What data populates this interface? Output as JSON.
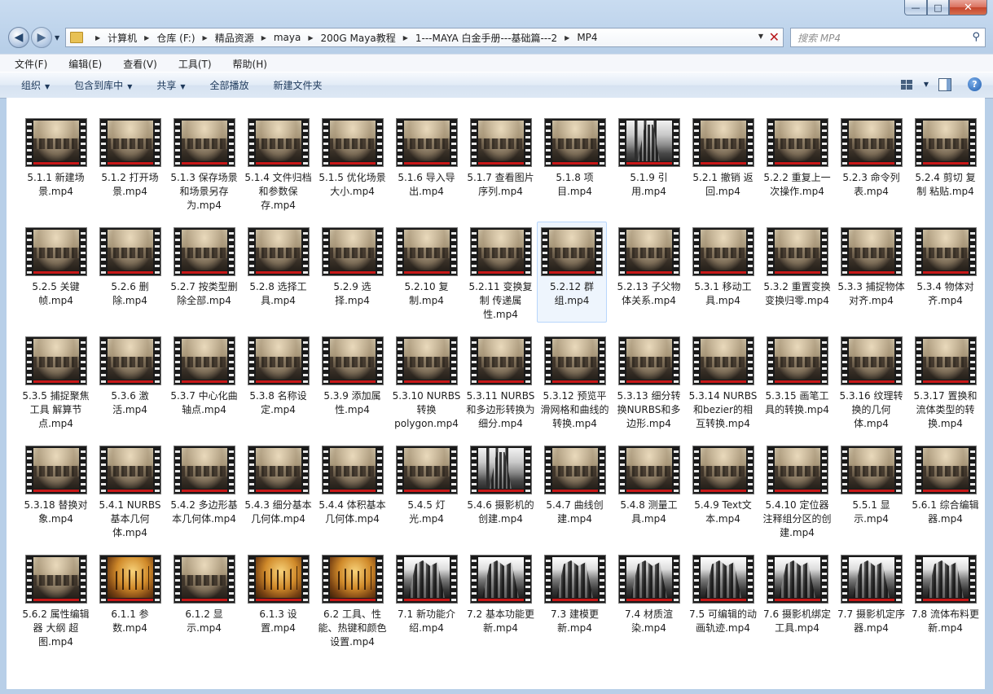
{
  "window": {
    "caption_min": "—",
    "caption_max": "□",
    "caption_close": "✕"
  },
  "nav": {
    "back_glyph": "◀",
    "forward_glyph": "▶",
    "breadcrumbs": [
      "计算机",
      "仓库 (F:)",
      "精品资源",
      "maya",
      "200G Maya教程",
      "1---MAYA 白金手册---基础篇---2",
      "MP4"
    ],
    "search_placeholder": "搜索 MP4"
  },
  "menu": [
    "文件(F)",
    "编辑(E)",
    "查看(V)",
    "工具(T)",
    "帮助(H)"
  ],
  "toolbar": {
    "organize": "组织",
    "include_library": "包含到库中",
    "share": "共享",
    "play_all": "全部播放",
    "new_folder": "新建文件夹",
    "help": "?"
  },
  "files": [
    {
      "name": "5.1.1 新建场景.mp4",
      "thumb": "ruins"
    },
    {
      "name": "5.1.2 打开场景.mp4",
      "thumb": "ruins"
    },
    {
      "name": "5.1.3 保存场景和场景另存为.mp4",
      "thumb": "ruins"
    },
    {
      "name": "5.1.4 文件归档和参数保存.mp4",
      "thumb": "ruins"
    },
    {
      "name": "5.1.5 优化场景大小.mp4",
      "thumb": "ruins"
    },
    {
      "name": "5.1.6 导入导出.mp4",
      "thumb": "ruins"
    },
    {
      "name": "5.1.7 查看图片序列.mp4",
      "thumb": "ruins"
    },
    {
      "name": "5.1.8 项目.mp4",
      "thumb": "ruins"
    },
    {
      "name": "5.1.9 引用.mp4",
      "thumb": "city"
    },
    {
      "name": "5.2.1 撤销 返回.mp4",
      "thumb": "ruins"
    },
    {
      "name": "5.2.2 重复上一次操作.mp4",
      "thumb": "ruins"
    },
    {
      "name": "5.2.3 命令列表.mp4",
      "thumb": "ruins"
    },
    {
      "name": "5.2.4 剪切 复制 粘贴.mp4",
      "thumb": "ruins"
    },
    {
      "name": "5.2.5 关键帧.mp4",
      "thumb": "ruins"
    },
    {
      "name": "5.2.6 删除.mp4",
      "thumb": "ruins"
    },
    {
      "name": "5.2.7 按类型删除全部.mp4",
      "thumb": "ruins"
    },
    {
      "name": "5.2.8 选择工具.mp4",
      "thumb": "ruins"
    },
    {
      "name": "5.2.9 选择.mp4",
      "thumb": "ruins"
    },
    {
      "name": "5.2.10 复制.mp4",
      "thumb": "ruins"
    },
    {
      "name": "5.2.11 变换复制 传递属性.mp4",
      "thumb": "ruins"
    },
    {
      "name": "5.2.12 群组.mp4",
      "thumb": "ruins",
      "selected": true
    },
    {
      "name": "5.2.13 子父物体关系.mp4",
      "thumb": "ruins"
    },
    {
      "name": "5.3.1 移动工具.mp4",
      "thumb": "ruins"
    },
    {
      "name": "5.3.2 重置变换 变换归零.mp4",
      "thumb": "ruins"
    },
    {
      "name": "5.3.3 捕捉物体对齐.mp4",
      "thumb": "ruins"
    },
    {
      "name": "5.3.4 物体对齐.mp4",
      "thumb": "ruins"
    },
    {
      "name": "5.3.5 捕捉聚焦工具 解算节点.mp4",
      "thumb": "ruins"
    },
    {
      "name": "5.3.6 激活.mp4",
      "thumb": "ruins"
    },
    {
      "name": "5.3.7 中心化曲轴点.mp4",
      "thumb": "ruins"
    },
    {
      "name": "5.3.8 名称设定.mp4",
      "thumb": "ruins"
    },
    {
      "name": "5.3.9 添加属性.mp4",
      "thumb": "ruins"
    },
    {
      "name": "5.3.10 NURBS转换polygon.mp4",
      "thumb": "ruins"
    },
    {
      "name": "5.3.11 NURBS和多边形转换为细分.mp4",
      "thumb": "ruins"
    },
    {
      "name": "5.3.12 预览平滑网格和曲线的转换.mp4",
      "thumb": "ruins"
    },
    {
      "name": "5.3.13 细分转换NURBS和多边形.mp4",
      "thumb": "ruins"
    },
    {
      "name": "5.3.14 NURBS和bezier的相互转换.mp4",
      "thumb": "ruins"
    },
    {
      "name": "5.3.15 画笔工具的转换.mp4",
      "thumb": "ruins"
    },
    {
      "name": "5.3.16 纹理转换的几何体.mp4",
      "thumb": "ruins"
    },
    {
      "name": "5.3.17 置换和流体类型的转换.mp4",
      "thumb": "ruins"
    },
    {
      "name": "5.3.18 替换对象.mp4",
      "thumb": "ruins"
    },
    {
      "name": "5.4.1 NURBS基本几何体.mp4",
      "thumb": "ruins"
    },
    {
      "name": "5.4.2 多边形基本几何体.mp4",
      "thumb": "ruins"
    },
    {
      "name": "5.4.3 细分基本几何体.mp4",
      "thumb": "ruins"
    },
    {
      "name": "5.4.4 体积基本几何体.mp4",
      "thumb": "ruins"
    },
    {
      "name": "5.4.5 灯光.mp4",
      "thumb": "ruins"
    },
    {
      "name": "5.4.6 摄影机的创建.mp4",
      "thumb": "city"
    },
    {
      "name": "5.4.7 曲线创建.mp4",
      "thumb": "ruins"
    },
    {
      "name": "5.4.8 测量工具.mp4",
      "thumb": "ruins"
    },
    {
      "name": "5.4.9 Text文本.mp4",
      "thumb": "ruins"
    },
    {
      "name": "5.4.10 定位器注释组分区的创建.mp4",
      "thumb": "ruins"
    },
    {
      "name": "5.5.1 显示.mp4",
      "thumb": "ruins"
    },
    {
      "name": "5.6.1 综合编辑器.mp4",
      "thumb": "ruins"
    },
    {
      "name": "5.6.2 属性编辑器 大纲 超图.mp4",
      "thumb": "ruins"
    },
    {
      "name": "6.1.1 参数.mp4",
      "thumb": "ship"
    },
    {
      "name": "6.1.2 显示.mp4",
      "thumb": "ruins"
    },
    {
      "name": "6.1.3 设置.mp4",
      "thumb": "ship"
    },
    {
      "name": "6.2 工具、性能、热键和颜色设置.mp4",
      "thumb": "ship"
    },
    {
      "name": "7.1 新功能介绍.mp4",
      "thumb": "city-bw"
    },
    {
      "name": "7.2 基本功能更新.mp4",
      "thumb": "city-bw"
    },
    {
      "name": "7.3 建模更新.mp4",
      "thumb": "city-bw"
    },
    {
      "name": "7.4 材质渲染.mp4",
      "thumb": "city-bw"
    },
    {
      "name": "7.5 可编辑的动画轨迹.mp4",
      "thumb": "city-bw"
    },
    {
      "name": "7.6 摄影机绑定工具.mp4",
      "thumb": "city-bw"
    },
    {
      "name": "7.7 摄影机定序器.mp4",
      "thumb": "city-bw"
    },
    {
      "name": "7.8 流体布料更新.mp4",
      "thumb": "city-bw"
    }
  ]
}
